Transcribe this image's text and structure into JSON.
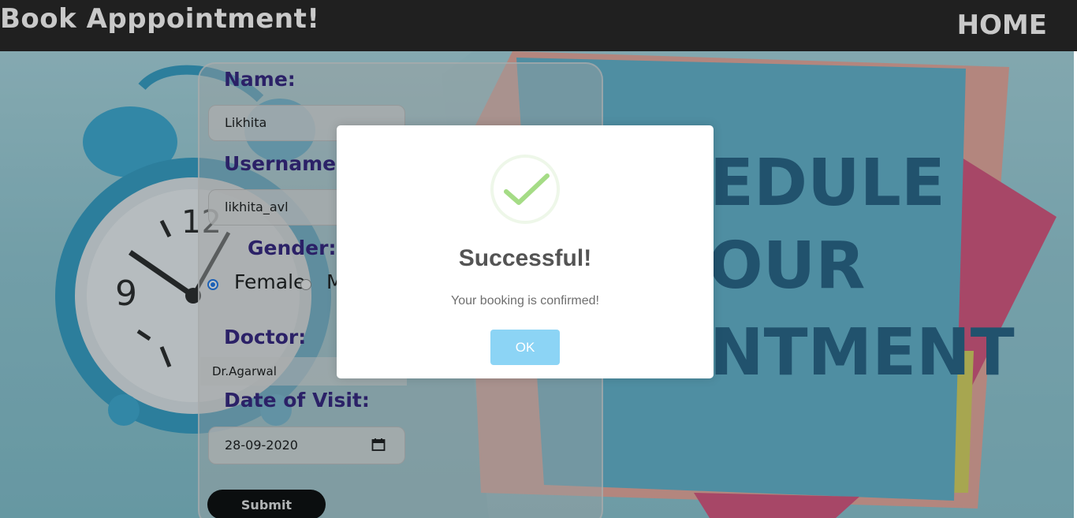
{
  "header": {
    "title": "Book Apppointment!",
    "nav_home": "HOME"
  },
  "form": {
    "name_label": "Name:",
    "name_value": "Likhita",
    "username_label": "Username:",
    "username_value": "likhita_avl",
    "gender_label": "Gender:",
    "gender_options": [
      "Female",
      "M"
    ],
    "gender_selected": "Female",
    "doctor_label": "Doctor:",
    "doctor_value": "Dr.Agarwal",
    "date_label": "Date of Visit:",
    "date_value": "28-09-2020",
    "submit_label": "Submit"
  },
  "background": {
    "note_text": [
      "EDULE",
      "OUR",
      "NTMENT"
    ]
  },
  "modal": {
    "title": "Successful!",
    "message": "Your booking is confirmed!",
    "ok_label": "OK",
    "icon": "checkmark-icon"
  },
  "colors": {
    "topbar": "#202020",
    "label": "#2d1b7a",
    "ok_button": "#8cd4f5",
    "check": "#a5dc86"
  }
}
